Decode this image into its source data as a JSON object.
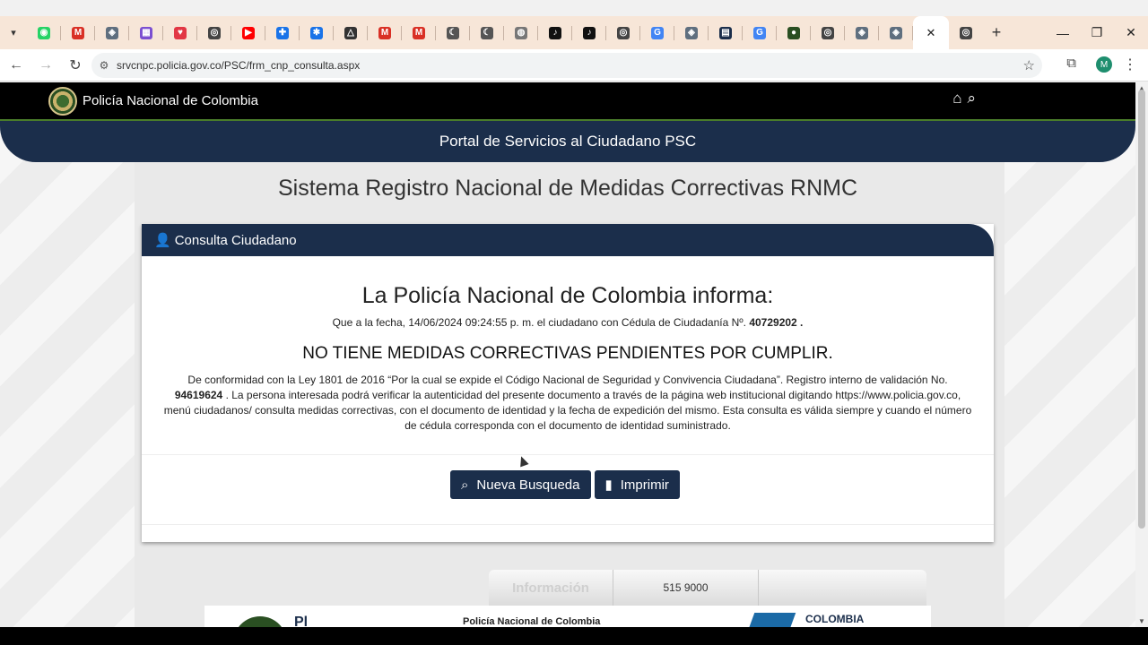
{
  "browser": {
    "tab_icons": [
      {
        "name": "whatsapp-icon",
        "color": "#25d366",
        "glyph": "◉"
      },
      {
        "name": "gmail-icon",
        "color": "#d93025",
        "glyph": "M"
      },
      {
        "name": "generic-site-icon",
        "color": "#5f6f7f",
        "glyph": "◈"
      },
      {
        "name": "colorful-grid-icon",
        "color": "#7b4fd1",
        "glyph": "▦"
      },
      {
        "name": "heart-icon",
        "color": "#e23744",
        "glyph": "♥"
      },
      {
        "name": "chrome-icon",
        "color": "#444444",
        "glyph": "◎"
      },
      {
        "name": "youtube-icon",
        "color": "#ff0000",
        "glyph": "▶"
      },
      {
        "name": "puzzle-icon",
        "color": "#1a73e8",
        "glyph": "✚"
      },
      {
        "name": "blue-circle-icon",
        "color": "#1a73e8",
        "glyph": "✱"
      },
      {
        "name": "drive-icon",
        "color": "#333333",
        "glyph": "△"
      },
      {
        "name": "gmail-icon",
        "color": "#d93025",
        "glyph": "M"
      },
      {
        "name": "gmail-icon",
        "color": "#d93025",
        "glyph": "M"
      },
      {
        "name": "moon-icon",
        "color": "#555555",
        "glyph": "☾"
      },
      {
        "name": "moon-icon",
        "color": "#555555",
        "glyph": "☾"
      },
      {
        "name": "globe-icon",
        "color": "#777777",
        "glyph": "◍"
      },
      {
        "name": "tiktok-icon",
        "color": "#111111",
        "glyph": "♪"
      },
      {
        "name": "tiktok-icon",
        "color": "#111111",
        "glyph": "♪"
      },
      {
        "name": "chrome-icon",
        "color": "#444444",
        "glyph": "◎"
      },
      {
        "name": "google-icon",
        "color": "#4285f4",
        "glyph": "G"
      },
      {
        "name": "generic-site-icon",
        "color": "#5f6f7f",
        "glyph": "◈"
      },
      {
        "name": "document-icon",
        "color": "#1b2e4b",
        "glyph": "▤"
      },
      {
        "name": "google-icon",
        "color": "#4285f4",
        "glyph": "G"
      },
      {
        "name": "police-crest-icon",
        "color": "#2a4f22",
        "glyph": "●"
      },
      {
        "name": "chrome-icon",
        "color": "#444444",
        "glyph": "◎"
      },
      {
        "name": "generic-site-icon",
        "color": "#5f6f7f",
        "glyph": "◈"
      },
      {
        "name": "generic-site-icon",
        "color": "#5f6f7f",
        "glyph": "◈"
      }
    ],
    "url": "srvcnpc.policia.gov.co/PSC/frm_cnp_consulta.aspx",
    "profile_initial": "M"
  },
  "header": {
    "brand": "Policía Nacional de Colombia",
    "portal_title": "Portal de Servicios al Ciudadano PSC"
  },
  "main": {
    "system_title": "Sistema Registro Nacional de Medidas Correctivas RNMC",
    "panel_title": "Consulta Ciudadano",
    "informa": "La Policía Nacional de Colombia informa:",
    "fecha_prefix": "Que a la fecha, 14/06/2024 09:24:55 p. m.  el ciudadano con Cédula de Ciudadanía Nº.",
    "cedula": "40729202 .",
    "status": "NO TIENE MEDIDAS CORRECTIVAS PENDIENTES POR CUMPLIR.",
    "legal_prefix": "De conformidad con la Ley 1801 de 2016 “Por la cual se expide el Código Nacional de Seguridad y Convivencia Ciudadana”. Registro interno de validación No.",
    "registro": "94619624",
    "legal_suffix": ". La persona interesada podrá verificar la autenticidad del presente documento a través de la página web institucional digitando https://www.policia.gov.co,   menú ciudadanos/ consulta medidas correctivas, con el documento de identidad y la fecha de expedición del mismo. Esta consulta es válida siempre y cuando el número de cédula corresponda con el documento de identidad suministrado.",
    "btn_new_search": "Nueva Busqueda",
    "btn_print": "Imprimir"
  },
  "footer": {
    "info_label": "Información",
    "phone": "515 9000",
    "footer_text": "Policía Nacional de Colombia",
    "logo_text_partial": "Pl",
    "colombia_text": "COLOMBIA"
  },
  "colors": {
    "navy": "#1b2e4b",
    "black_bar": "#000000"
  }
}
